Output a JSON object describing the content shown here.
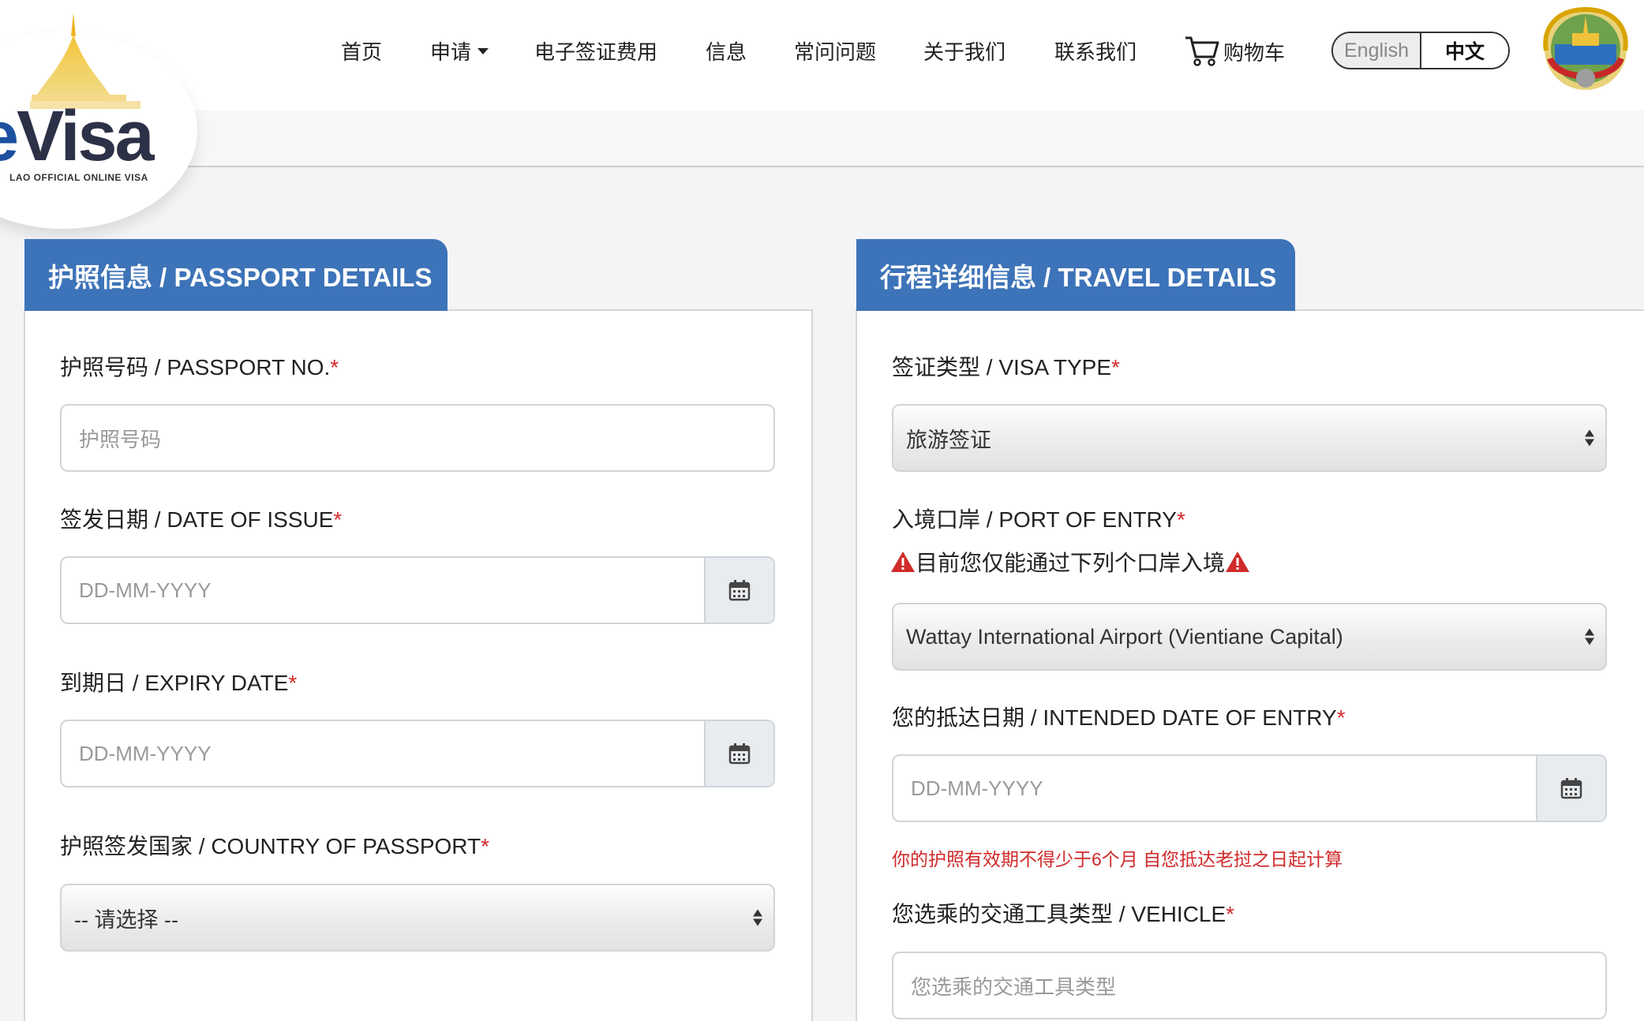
{
  "logo": {
    "brand": "eVisa",
    "subtitle": "LAO OFFICIAL ONLINE VISA"
  },
  "nav": {
    "items": [
      {
        "label": "首页"
      },
      {
        "label": "申请"
      },
      {
        "label": "电子签证费用"
      },
      {
        "label": "信息"
      },
      {
        "label": "常问问题"
      },
      {
        "label": "关于我们"
      },
      {
        "label": "联系我们"
      }
    ],
    "cart_label": "购物车",
    "lang_english": "English",
    "lang_chinese": "中文"
  },
  "passport": {
    "tab_title": "护照信息 / PASSPORT DETAILS",
    "passport_no_label": "护照号码 / PASSPORT NO.",
    "passport_no_placeholder": "护照号码",
    "issue_label": "签发日期 / DATE OF ISSUE",
    "issue_placeholder": "DD-MM-YYYY",
    "expiry_label": "到期日 / EXPIRY DATE",
    "expiry_placeholder": "DD-MM-YYYY",
    "country_label": "护照签发国家 / COUNTRY OF PASSPORT",
    "country_value": "-- 请选择 --"
  },
  "travel": {
    "tab_title": "行程详细信息 / TRAVEL DETAILS",
    "visa_type_label": "签证类型 / VISA TYPE",
    "visa_type_value": "旅游签证",
    "port_label": "入境口岸 / PORT OF ENTRY",
    "port_warning": "目前您仅能通过下列个口岸入境",
    "port_value": "Wattay International Airport (Vientiane Capital)",
    "entry_date_label": "您的抵达日期 / INTENDED DATE OF ENTRY",
    "entry_date_placeholder": "DD-MM-YYYY",
    "entry_hint": "你的护照有效期不得少于6个月 自您抵达老挝之日起计算",
    "vehicle_label": "您选乘的交通工具类型 / VEHICLE",
    "vehicle_placeholder": "您选乘的交通工具类型"
  },
  "required_mark": "*",
  "colors": {
    "tab_blue": "#3d73b8",
    "required_red": "#d02a2a"
  }
}
